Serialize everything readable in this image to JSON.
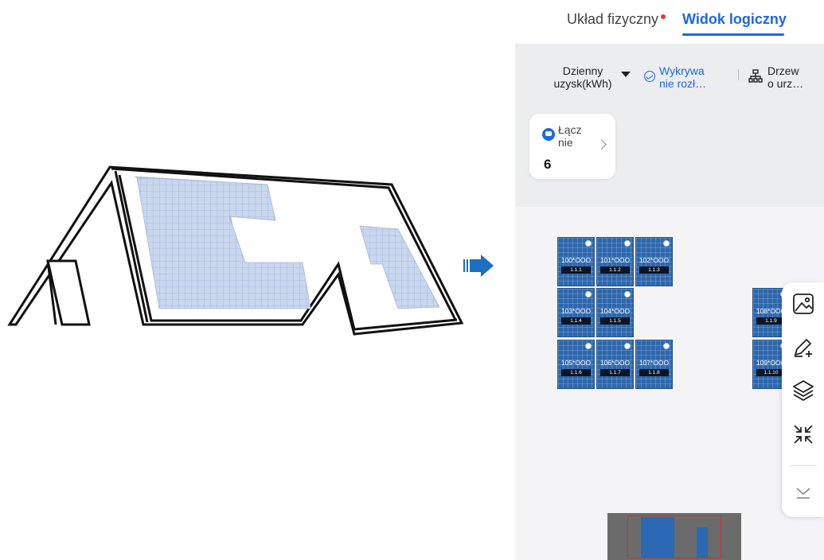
{
  "tabs": {
    "physical": "Układ fizyczny",
    "logical": "Widok logiczny"
  },
  "toolbar": {
    "yield_line1": "Dzienny",
    "yield_line2": "uzysk(kWh)",
    "curve_line1": "Wykrywa",
    "curve_line2": "nie rozł…",
    "tree_line1": "Drzew",
    "tree_line2": "o urz…"
  },
  "card": {
    "label_line1": "Łącz",
    "label_line2": "nie",
    "count": "6"
  },
  "panels": [
    {
      "name": "100*OOO",
      "id": "1.1.1"
    },
    {
      "name": "101*OOO",
      "id": "1.1.2"
    },
    {
      "name": "102*OOO",
      "id": "1.1.3"
    },
    {
      "name": "103*OOO",
      "id": "1.1.4"
    },
    {
      "name": "104*OOO",
      "id": "1.1.5"
    },
    {
      "name": "105*OOO",
      "id": "1.1.6"
    },
    {
      "name": "106*OOO",
      "id": "1.1.7"
    },
    {
      "name": "107*OOO",
      "id": "1.1.8"
    },
    {
      "name": "108*OOO",
      "id": "1.1.9"
    },
    {
      "name": "109*OOO",
      "id": "1.1.10"
    }
  ],
  "colors": {
    "accent": "#1e66e5",
    "panel": "#2d67ad",
    "alert_dot": "#e53935"
  },
  "icons": [
    "image-icon",
    "edit-icon",
    "layers-icon",
    "collapse-icon",
    "chevron-down-icon",
    "tree-icon",
    "curve-icon",
    "chat-icon"
  ]
}
